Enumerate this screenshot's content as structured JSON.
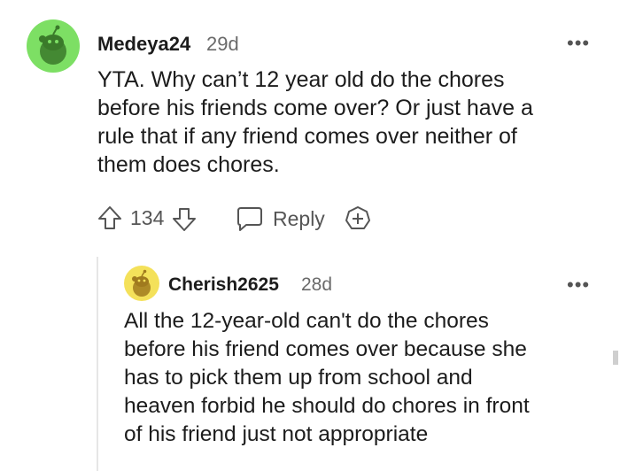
{
  "comments": [
    {
      "username": "Medeya24",
      "age": "29d",
      "text_lines": [
        "YTA. Why can’t 12 year old do the chores",
        "before his friends come over? Or just have a",
        "rule that if any friend comes over neither of",
        "them does chores."
      ],
      "votes": "134",
      "reply_label": "Reply",
      "more_label": "•••",
      "avatar_color": "#7ddf64"
    },
    {
      "username": "Cherish2625",
      "age": "28d",
      "text_lines": [
        "All the 12-year-old can't do the chores",
        "before his friend comes over because she",
        "has to pick them up from school and",
        "heaven forbid he should do chores in front",
        "of his friend just not appropriate"
      ],
      "more_label": "•••",
      "avatar_color": "#f4e15a"
    }
  ],
  "icons": {
    "upvote": "arrow-up-icon",
    "downvote": "arrow-down-icon",
    "reply": "speech-bubble-icon",
    "award": "plus-circle-icon",
    "more": "ellipsis-icon"
  }
}
